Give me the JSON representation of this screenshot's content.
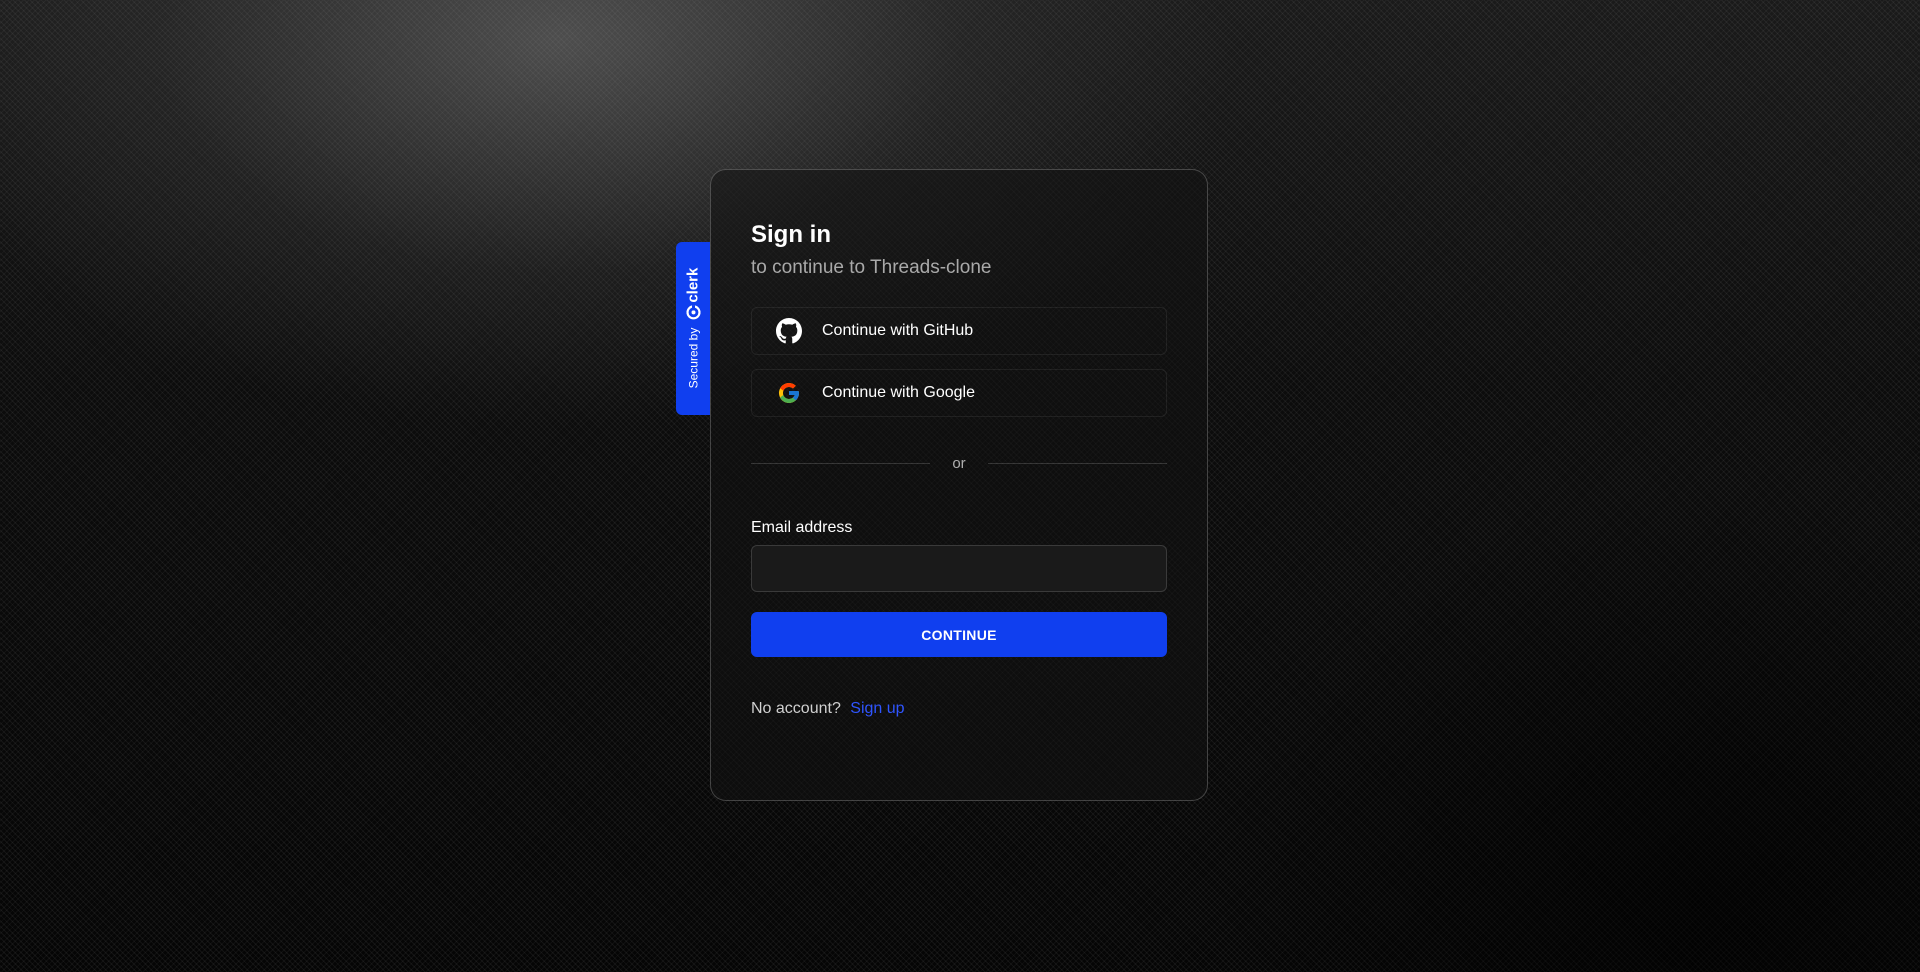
{
  "badge": {
    "secured_text": "Secured by",
    "brand": "clerk",
    "color": "#103fef"
  },
  "signin": {
    "title": "Sign in",
    "subtitle": "to continue to Threads-clone",
    "social_buttons": [
      {
        "label": "Continue with GitHub",
        "icon": "github-icon"
      },
      {
        "label": "Continue with Google",
        "icon": "google-icon"
      }
    ],
    "divider_text": "or",
    "email_label": "Email address",
    "email_value": "",
    "continue_label": "CONTINUE",
    "footer_text": "No account?",
    "footer_link": "Sign up"
  },
  "colors": {
    "accent": "#103fef",
    "link": "#2f55ff"
  }
}
